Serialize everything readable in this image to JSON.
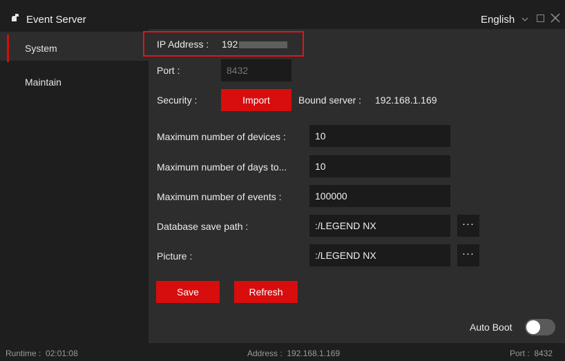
{
  "window": {
    "title": "Event Server",
    "language": "English"
  },
  "sidebar": {
    "items": [
      {
        "label": "System"
      },
      {
        "label": "Maintain"
      }
    ]
  },
  "form": {
    "ip_label": "IP Address :",
    "ip_value": "192",
    "port_label": "Port :",
    "port_placeholder": "8432",
    "security_label": "Security :",
    "import_label": "Import",
    "bound_server_label": "Bound server :",
    "bound_server_value": "192.168.1.169",
    "max_devices_label": "Maximum number of devices :",
    "max_devices_value": "10",
    "max_days_label": "Maximum number of days to...",
    "max_days_value": "10",
    "max_events_label": "Maximum number of events :",
    "max_events_value": "100000",
    "db_path_label": "Database save path :",
    "db_path_value": ":/LEGEND NX",
    "picture_label": "Picture :",
    "picture_value": ":/LEGEND NX",
    "save_label": "Save",
    "refresh_label": "Refresh",
    "auto_boot_label": "Auto Boot",
    "auto_boot_on": false
  },
  "status": {
    "runtime_label": "Runtime :",
    "runtime_value": "02:01:08",
    "address_label": "Address :",
    "address_value": "192.168.1.169",
    "port_label": "Port :",
    "port_value": "8432"
  },
  "colors": {
    "accent": "#d80d0d",
    "highlight": "#e3141b",
    "background": "#2d2d2d",
    "panel": "#1e1e1e"
  },
  "icons": {
    "app": "app-logo-icon",
    "dropdown": "chevron-down-icon",
    "maximize": "maximize-icon",
    "close": "close-icon",
    "browse": "more-dots-icon"
  }
}
